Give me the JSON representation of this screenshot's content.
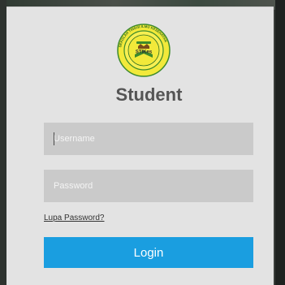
{
  "login_form": {
    "title": "Student",
    "username_placeholder": "Username",
    "password_placeholder": "Password",
    "forgot_password_link": "Lupa Password?",
    "login_button": "Login"
  },
  "logo": {
    "text": "STIKes",
    "ring_text": "SEKOLAH TINGGI ILMU KESEHATAN"
  },
  "colors": {
    "panel_background": "#e3e3e3",
    "input_background": "#cacaca",
    "login_button": "#1a9ee0",
    "title": "#555555",
    "logo_yellow": "#f2e93a",
    "logo_green": "#3d8a2c"
  }
}
